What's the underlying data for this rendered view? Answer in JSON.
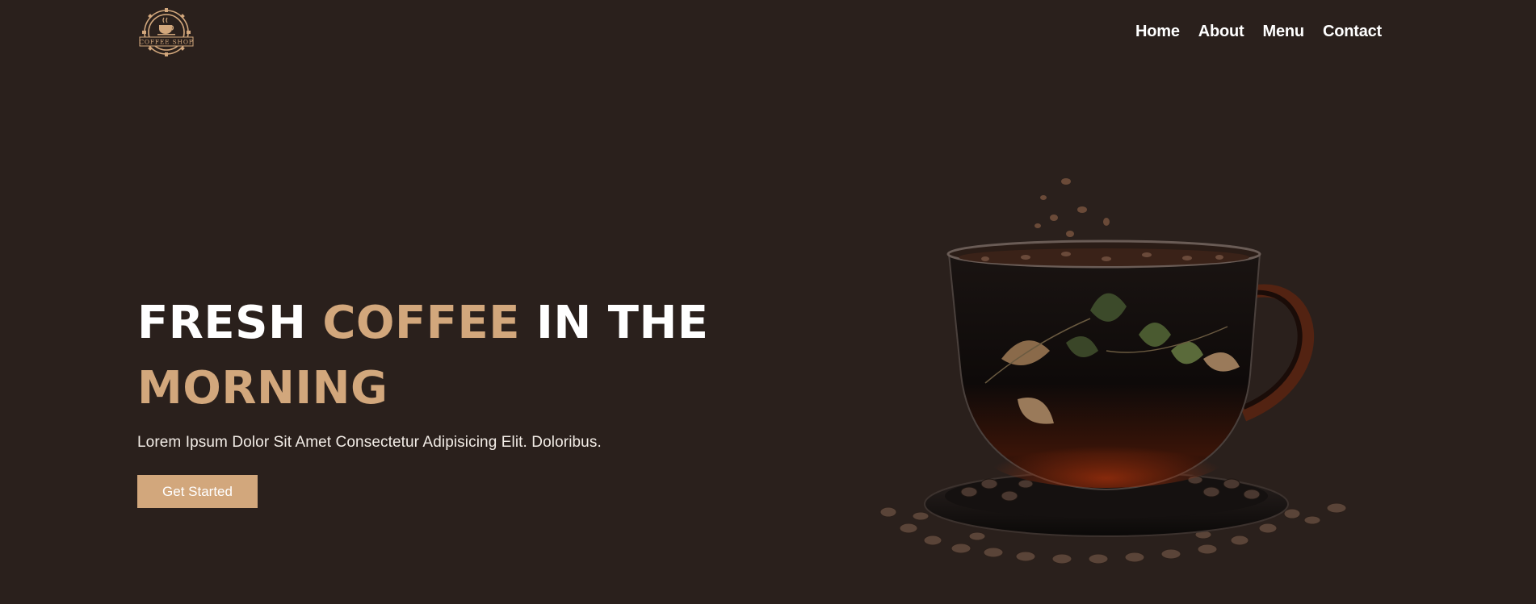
{
  "brand": {
    "logo_text": "COFFEE SHOP",
    "colors": {
      "background": "#2a201c",
      "accent": "#d2a77c",
      "text": "#ffffff"
    }
  },
  "nav": {
    "items": [
      {
        "label": "Home"
      },
      {
        "label": "About"
      },
      {
        "label": "Menu"
      },
      {
        "label": "Contact"
      }
    ]
  },
  "hero": {
    "title_parts": [
      "FRESH ",
      "COFFEE",
      " IN THE ",
      "MORNING"
    ],
    "subtitle": "Lorem Ipsum Dolor Sit Amet Consectetur Adipisicing Elit. Doloribus.",
    "cta_label": "Get Started",
    "image": "coffee-cup-with-beans"
  }
}
